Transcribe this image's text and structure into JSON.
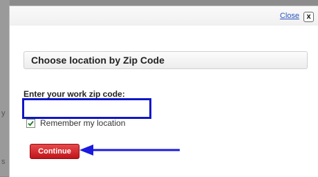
{
  "dialog": {
    "close_label": "Close",
    "close_icon_glyph": "x",
    "heading": "Choose location by Zip Code",
    "zip_label": "Enter your work zip code:",
    "zip_value": "",
    "remember_label": "Remember my location",
    "remember_checked": true,
    "continue_label": "Continue"
  },
  "colors": {
    "input_highlight": "#1016c7",
    "continue_button": "#d42026",
    "arrow": "#1a1ae0",
    "link": "#2a52be"
  }
}
